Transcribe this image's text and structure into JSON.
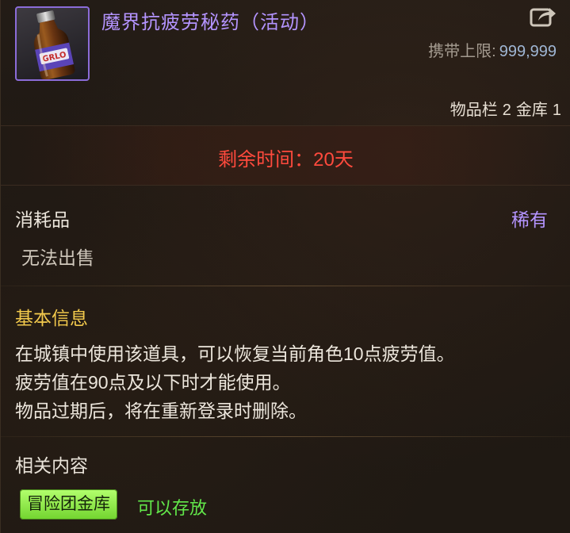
{
  "item": {
    "name": "魔界抗疲劳秘药（活动）",
    "icon": "potion-bottle-icon",
    "name_color": "#b494ff"
  },
  "header": {
    "carry_limit_label": "携带上限:",
    "carry_limit_value": "999,999",
    "storage_label": "物品栏",
    "storage_value": "2",
    "bank_label": "金库",
    "bank_value": "1",
    "share_icon": "share-export-icon"
  },
  "timer": {
    "text": "剩余时间：20天",
    "color": "#ff4a3d"
  },
  "info": {
    "category": "消耗品",
    "rarity": "稀有",
    "rarity_color": "#b494ff",
    "sell_status": "无法出售"
  },
  "basic": {
    "title": "基本信息",
    "lines": [
      "在城镇中使用该道具，可以恢复当前角色10点疲劳值。",
      "疲劳值在90点及以下时才能使用。",
      "物品过期后，将在重新登录时删除。"
    ]
  },
  "related": {
    "title": "相关内容",
    "tag_label": "冒险团金库",
    "tag_status": "可以存放",
    "tag_color": "#9ff05a",
    "status_color": "#62e84a"
  }
}
